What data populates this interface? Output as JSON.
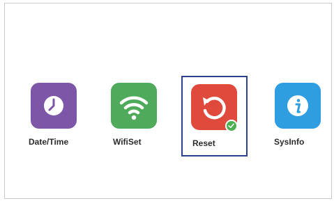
{
  "apps": [
    {
      "label": "Date/Time",
      "icon": "clock-icon",
      "color": "#7e56a8"
    },
    {
      "label": "WifiSet",
      "icon": "wifi-icon",
      "color": "#4fab5b"
    },
    {
      "label": "Reset",
      "icon": "reset-icon",
      "color": "#e04a3d",
      "selected": true,
      "badge": "check-icon"
    },
    {
      "label": "SysInfo",
      "icon": "info-icon",
      "color": "#2e9ee0"
    }
  ],
  "selection_color": "#2b3f8f"
}
